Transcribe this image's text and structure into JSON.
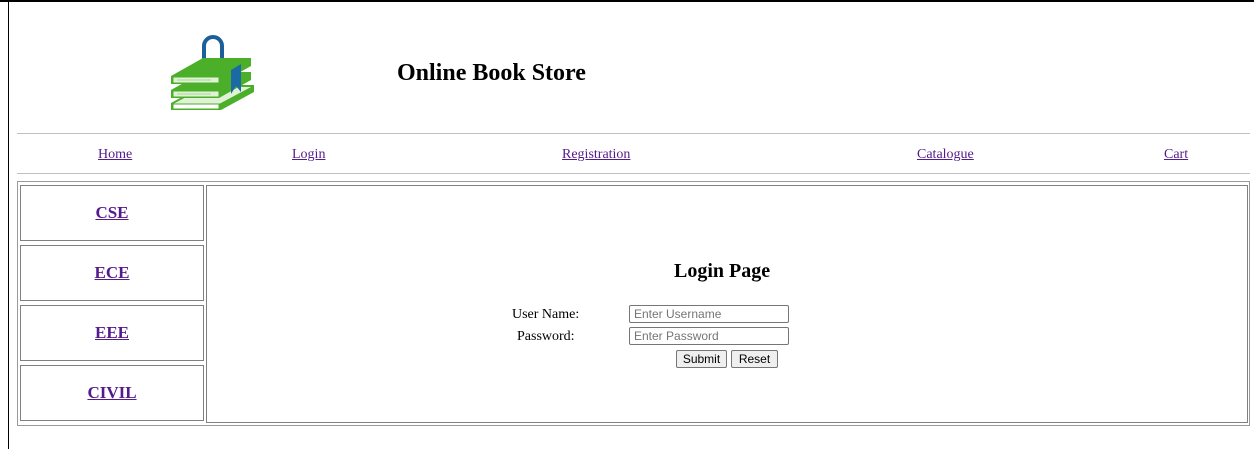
{
  "header": {
    "title": "Online Book Store",
    "logo_icon": "books-shopping-bag-icon",
    "colors": {
      "bag": "#1d5f9a",
      "book_green": "#4caf2a",
      "book_light": "#dff2d6",
      "bookmark": "#1b6aa5"
    }
  },
  "nav": {
    "items": [
      {
        "label": "Home"
      },
      {
        "label": "Login"
      },
      {
        "label": "Registration"
      },
      {
        "label": "Catalogue"
      },
      {
        "label": "Cart"
      }
    ]
  },
  "sidebar": {
    "items": [
      {
        "label": "CSE"
      },
      {
        "label": "ECE"
      },
      {
        "label": "EEE"
      },
      {
        "label": "CIVIL"
      }
    ]
  },
  "login": {
    "title": "Login Page",
    "username_label": "User Name:",
    "username_placeholder": "Enter Username",
    "username_value": "",
    "password_label": "Password:",
    "password_placeholder": "Enter Password",
    "password_value": "",
    "submit_label": "Submit",
    "reset_label": "Reset"
  },
  "colors": {
    "link_visited": "#551a8b",
    "border": "#808080"
  }
}
